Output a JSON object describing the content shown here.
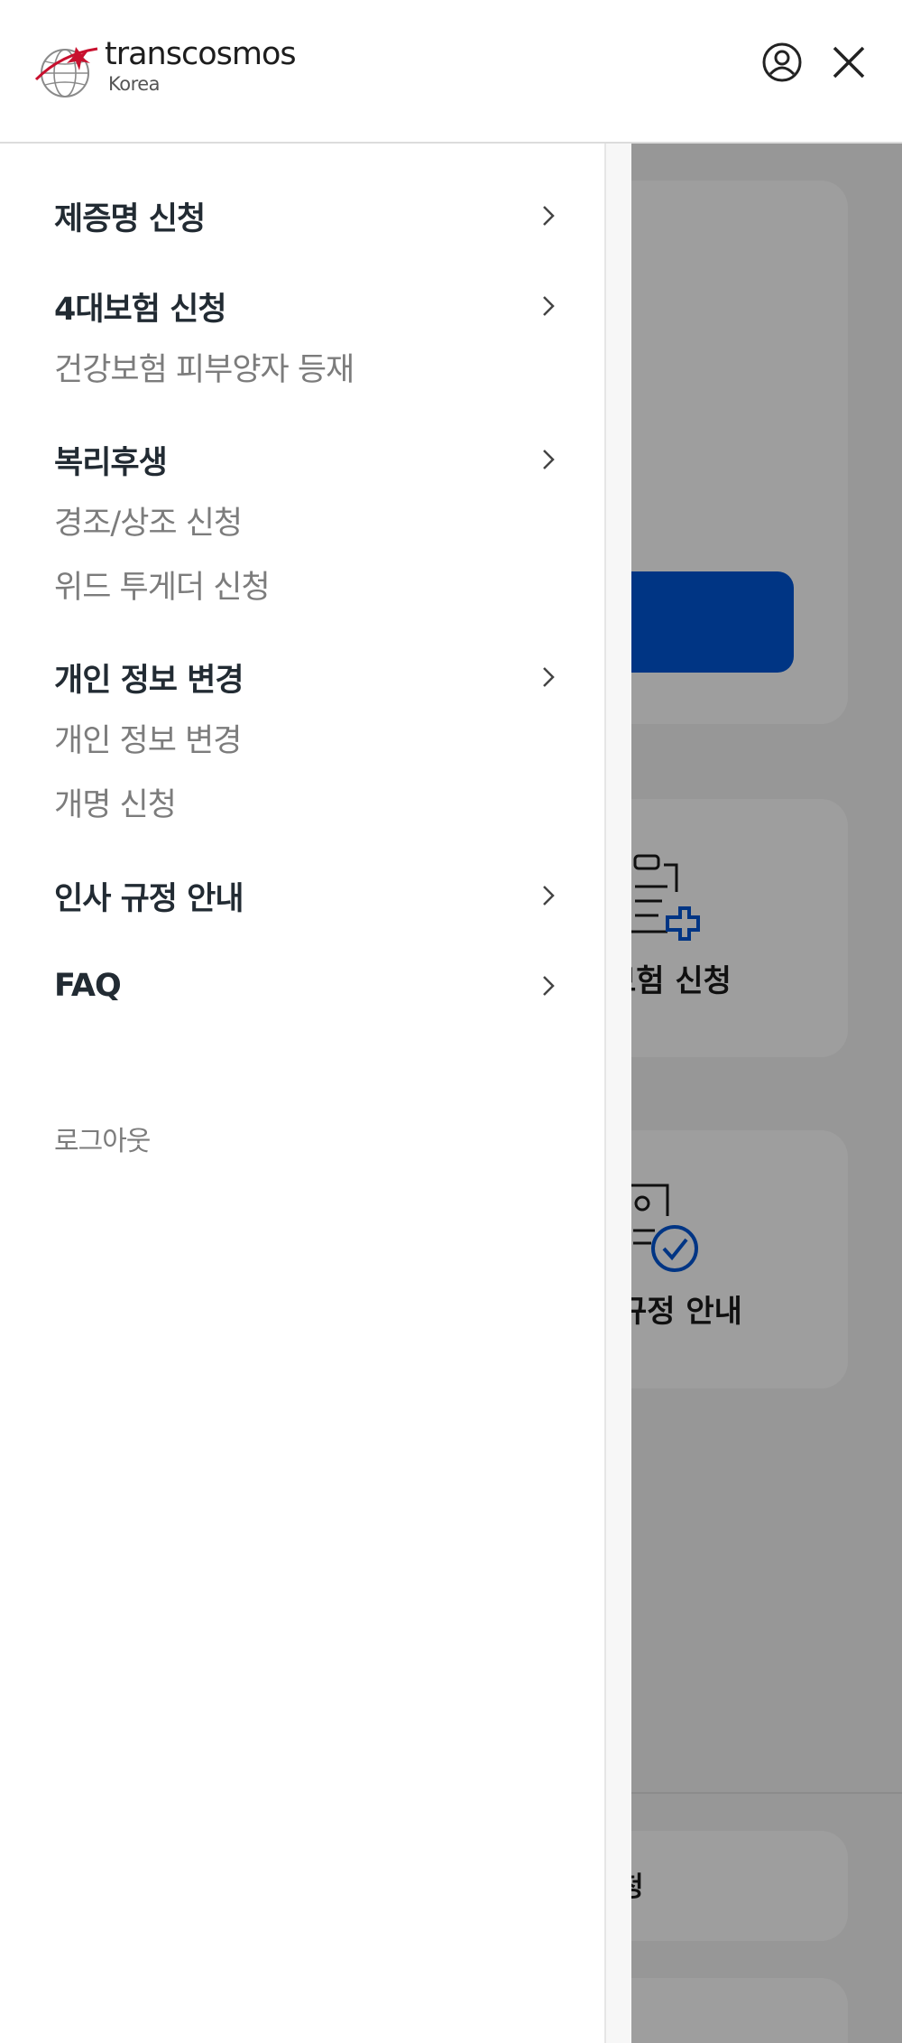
{
  "header": {
    "logo_text": "transcosmos",
    "logo_sub": "Korea",
    "icons": {
      "user": "user-circle-icon",
      "close": "close-icon"
    }
  },
  "menu": {
    "sections": [
      {
        "label": "제증명 신청",
        "items": []
      },
      {
        "label": "4대보험 신청",
        "items": [
          "건강보험 피부양자 등재"
        ]
      },
      {
        "label": "복리후생",
        "items": [
          "경조/상조 신청",
          "위드 투게더 신청"
        ]
      },
      {
        "label": "개인 정보 변경",
        "items": [
          "개인 정보 변경",
          "개명 신청"
        ]
      },
      {
        "label": "인사 규정 안내",
        "items": []
      },
      {
        "label": "FAQ",
        "items": []
      }
    ],
    "logout_label": "로그아웃"
  },
  "background": {
    "card2_label": "보험 신청",
    "card3_label": "규정 안내",
    "card4_label": "청",
    "accent_color": "#0056d6"
  }
}
